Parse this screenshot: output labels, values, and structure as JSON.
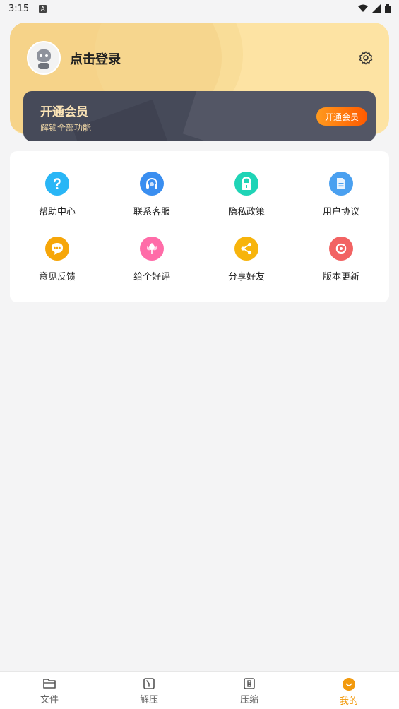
{
  "status": {
    "time": "3:15",
    "indicator": "A"
  },
  "header": {
    "login_label": "点击登录"
  },
  "vip": {
    "title": "开通会员",
    "subtitle": "解锁全部功能",
    "button_label": "开通会员"
  },
  "menu": [
    {
      "label": "帮助中心",
      "icon": "help-icon",
      "color": "#29b6f6"
    },
    {
      "label": "联系客服",
      "icon": "headset-icon",
      "color": "#3a8ef0"
    },
    {
      "label": "隐私政策",
      "icon": "lock-icon",
      "color": "#1fd4b6"
    },
    {
      "label": "用户协议",
      "icon": "document-icon",
      "color": "#4aa0f0"
    },
    {
      "label": "意见反馈",
      "icon": "feedback-icon",
      "color": "#f6a609"
    },
    {
      "label": "给个好评",
      "icon": "flower-icon",
      "color": "#ff6ca8"
    },
    {
      "label": "分享好友",
      "icon": "share-icon",
      "color": "#f7b40c"
    },
    {
      "label": "版本更新",
      "icon": "update-icon",
      "color": "#f26363"
    }
  ],
  "tabs": [
    {
      "label": "文件",
      "icon": "folder-icon"
    },
    {
      "label": "解压",
      "icon": "unzip-icon"
    },
    {
      "label": "压缩",
      "icon": "compress-icon"
    },
    {
      "label": "我的",
      "icon": "profile-icon",
      "active": true
    }
  ],
  "colors": {
    "accent": "#f29a0e",
    "hero_bg": "#fde3a3",
    "vip_bg": "#464a59"
  }
}
